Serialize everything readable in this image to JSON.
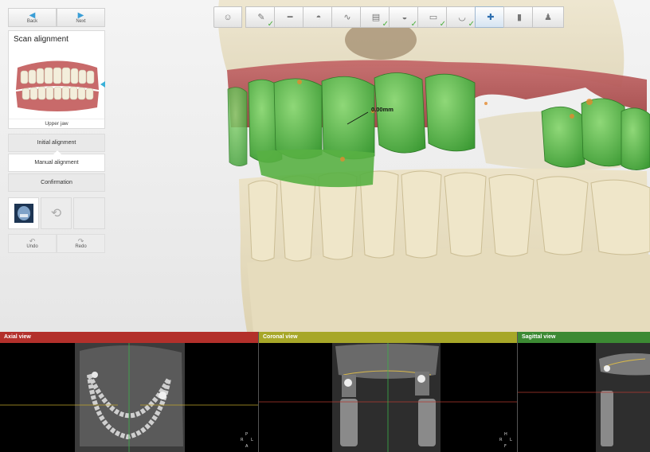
{
  "toolbar": {
    "steps": [
      {
        "icon": "patient-icon",
        "done": false
      },
      {
        "icon": "prescription-icon",
        "done": true
      },
      {
        "icon": "scanner-icon",
        "done": false
      },
      {
        "icon": "bell-implant-icon",
        "done": false
      },
      {
        "icon": "nerve-icon",
        "done": false
      },
      {
        "icon": "scan-import-icon",
        "done": true
      },
      {
        "icon": "tooth-icon",
        "done": true
      },
      {
        "icon": "crop-icon",
        "done": true
      },
      {
        "icon": "arch-icon",
        "done": true
      },
      {
        "icon": "alignment-icon",
        "done": false,
        "active": true
      },
      {
        "icon": "implant-icon",
        "done": false
      },
      {
        "icon": "doctor-icon",
        "done": false
      }
    ]
  },
  "nav": {
    "back_label": "Back",
    "next_label": "Next"
  },
  "scan": {
    "title": "Scan alignment",
    "jaw_label": "Upper jaw",
    "steps": [
      "Initial alignment",
      "Manual alignment",
      "Confirmation"
    ],
    "active_step": "Manual alignment"
  },
  "history": {
    "undo_label": "Undo",
    "redo_label": "Redo"
  },
  "measurement": "0.00mm",
  "views": {
    "axial": "Axial view",
    "coronal": "Coronal view",
    "sagittal": "Sagittal view"
  },
  "orientation": {
    "axial": {
      "top": "P",
      "left": "R",
      "right": "L",
      "bottom": "A"
    },
    "coronal": {
      "top": "H",
      "left": "R",
      "right": "L",
      "bottom": "F"
    }
  },
  "colors": {
    "axial": "#b3302b",
    "coronal": "#a7a728",
    "sagittal": "#3c8a33",
    "accent": "#3a9ed6",
    "check": "#4caf3d"
  }
}
